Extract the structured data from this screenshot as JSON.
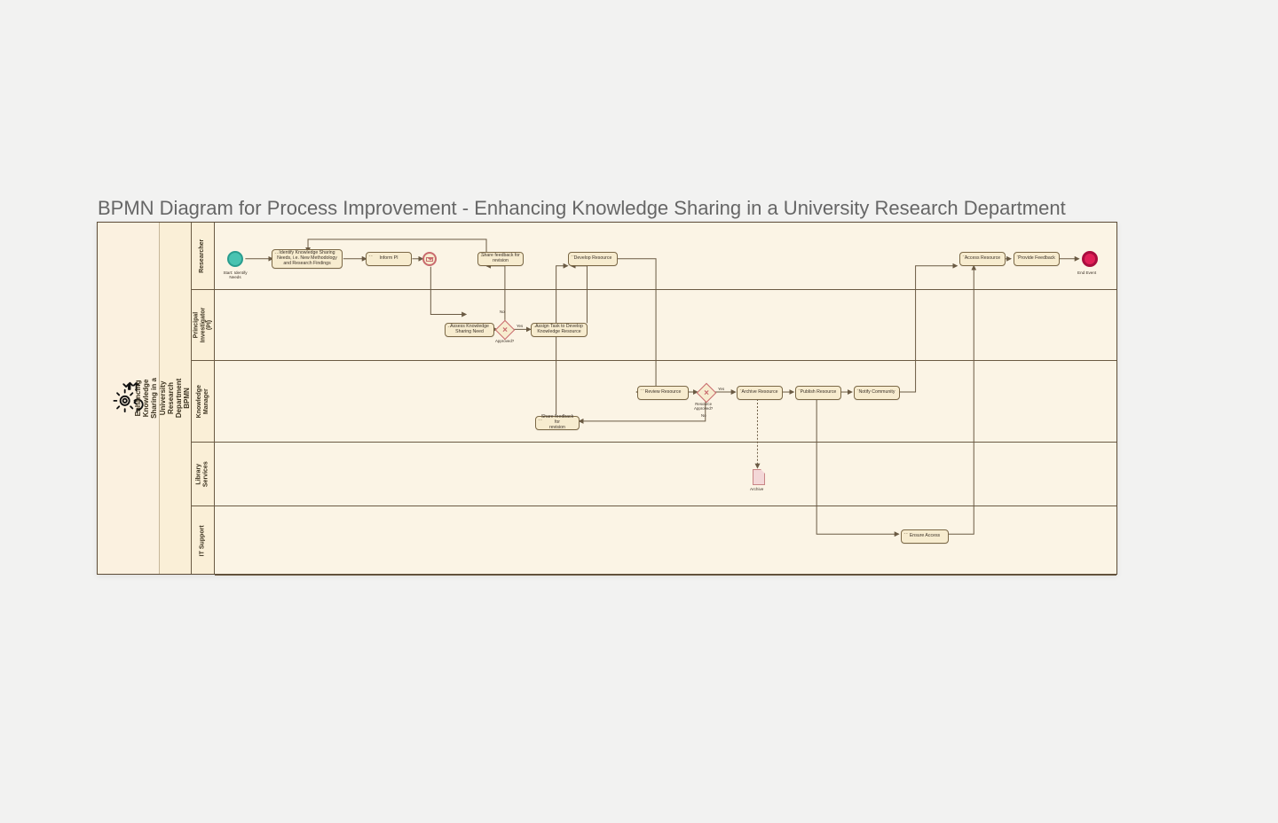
{
  "title": "BPMN Diagram for Process Improvement - Enhancing Knowledge Sharing in a University Research Department",
  "pool_title": "Enhancing Knowledge Sharing in a University Research Department\nBPMN Process Improvement Diagram",
  "lanes": {
    "researcher": "Researcher",
    "pi": "Principal Investigator\n(PI)",
    "km": "Knowledge\nManager",
    "lib": "Library\nServices",
    "it": "IT Support"
  },
  "events": {
    "start": "Start: Identify\nNeeds",
    "end": "End Event"
  },
  "gateways": {
    "approved": "Approved?",
    "resource_approved": "Resource\nApproved?"
  },
  "edge_labels": {
    "yes": "Yes",
    "no": "No"
  },
  "tasks": {
    "identify_needs": "Identify Knowledge Sharing\nNeeds, i.e. New Methodology\nand Research Findings",
    "inform_pi": "Inform PI",
    "share_feedback_researcher": "Share feedback for\nrevision",
    "develop_resource": "Develop Resource",
    "access_resource": "Access Resource",
    "provide_feedback": "Provide Feedback",
    "assess_need": "Assess Knowledge\nSharing Need",
    "assign_task": "Assign Task to Develop\nKnowledge Resource",
    "review_resource": "Review Resource",
    "archive_resource": "Archive Resource",
    "publish_resource": "Publish Resource",
    "notify_community": "Notify Community",
    "share_feedback_km": "Share feedback for\nrevision",
    "ensure_access": "Ensure Access",
    "archive_label": "Archive"
  },
  "chart_data": {
    "type": "bpmn",
    "pool": "Enhancing Knowledge Sharing in a University Research Department — BPMN Process Improvement Diagram",
    "lanes": [
      "Researcher",
      "Principal Investigator (PI)",
      "Knowledge Manager",
      "Library Services",
      "IT Support"
    ],
    "elements": [
      {
        "id": "start",
        "type": "startEvent",
        "lane": "Researcher",
        "label": "Start: Identify Needs"
      },
      {
        "id": "t1",
        "type": "task",
        "lane": "Researcher",
        "label": "Identify Knowledge Sharing Needs, i.e. New Methodology and Research Findings"
      },
      {
        "id": "t2",
        "type": "task",
        "lane": "Researcher",
        "label": "Inform PI"
      },
      {
        "id": "m1",
        "type": "intermediateMessageEvent",
        "lane": "Researcher"
      },
      {
        "id": "t3",
        "type": "task",
        "lane": "Researcher",
        "label": "Share feedback for revision"
      },
      {
        "id": "t4",
        "type": "task",
        "lane": "Researcher",
        "label": "Develop Resource"
      },
      {
        "id": "t10",
        "type": "task",
        "lane": "Researcher",
        "label": "Access Resource"
      },
      {
        "id": "t11",
        "type": "task",
        "lane": "Researcher",
        "label": "Provide Feedback"
      },
      {
        "id": "end",
        "type": "endEvent",
        "lane": "Researcher",
        "label": "End Event"
      },
      {
        "id": "t5",
        "type": "task",
        "lane": "Principal Investigator (PI)",
        "label": "Assess Knowledge Sharing Need"
      },
      {
        "id": "g1",
        "type": "exclusiveGateway",
        "lane": "Principal Investigator (PI)",
        "label": "Approved?"
      },
      {
        "id": "t6",
        "type": "task",
        "lane": "Principal Investigator (PI)",
        "label": "Assign Task to Develop Knowledge Resource"
      },
      {
        "id": "t7",
        "type": "task",
        "lane": "Knowledge Manager",
        "label": "Review Resource"
      },
      {
        "id": "g2",
        "type": "exclusiveGateway",
        "lane": "Knowledge Manager",
        "label": "Resource Approved?"
      },
      {
        "id": "t8",
        "type": "task",
        "lane": "Knowledge Manager",
        "label": "Archive Resource"
      },
      {
        "id": "t9",
        "type": "task",
        "lane": "Knowledge Manager",
        "label": "Publish Resource"
      },
      {
        "id": "t12",
        "type": "task",
        "lane": "Knowledge Manager",
        "label": "Notify Community"
      },
      {
        "id": "t13",
        "type": "task",
        "lane": "Knowledge Manager",
        "label": "Share feedback for revision"
      },
      {
        "id": "d1",
        "type": "dataObject",
        "lane": "Library Services",
        "label": "Archive"
      },
      {
        "id": "t14",
        "type": "task",
        "lane": "IT Support",
        "label": "Ensure Access"
      }
    ],
    "flows": [
      {
        "from": "start",
        "to": "t1"
      },
      {
        "from": "t1",
        "to": "t2"
      },
      {
        "from": "t2",
        "to": "m1"
      },
      {
        "from": "m1",
        "to": "t5"
      },
      {
        "from": "t5",
        "to": "g1"
      },
      {
        "from": "g1",
        "to": "t3",
        "label": "No"
      },
      {
        "from": "t3",
        "to": "t1"
      },
      {
        "from": "g1",
        "to": "t6",
        "label": "Yes"
      },
      {
        "from": "t6",
        "to": "t4"
      },
      {
        "from": "t4",
        "to": "t7"
      },
      {
        "from": "t7",
        "to": "g2"
      },
      {
        "from": "g2",
        "to": "t13",
        "label": "No"
      },
      {
        "from": "t13",
        "to": "t4"
      },
      {
        "from": "g2",
        "to": "t8",
        "label": "Yes"
      },
      {
        "from": "t8",
        "to": "d1",
        "type": "dataAssociation"
      },
      {
        "from": "t8",
        "to": "t9"
      },
      {
        "from": "t9",
        "to": "t14"
      },
      {
        "from": "t9",
        "to": "t12"
      },
      {
        "from": "t12",
        "to": "t10"
      },
      {
        "from": "t14",
        "to": "t10"
      },
      {
        "from": "t10",
        "to": "t11"
      },
      {
        "from": "t11",
        "to": "end"
      }
    ]
  }
}
